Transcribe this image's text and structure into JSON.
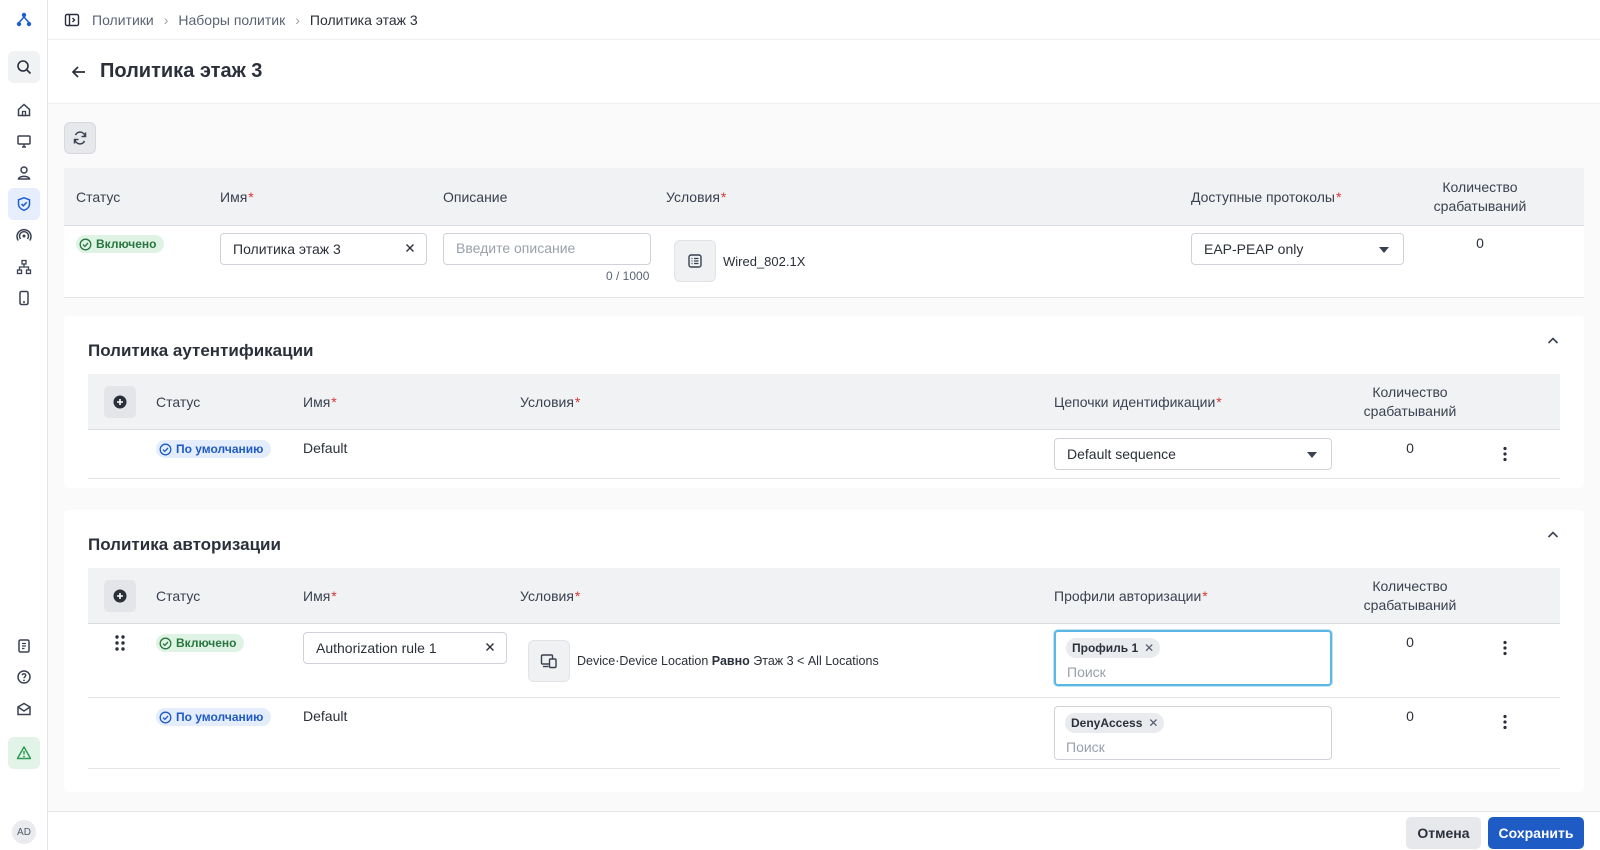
{
  "nav": {
    "avatar_initials": "AD",
    "icons": [
      "logo-icon",
      "search-icon",
      "home-icon",
      "monitor-icon",
      "user-icon",
      "shield-icon",
      "broadcast-icon",
      "network-icon",
      "mobile-icon",
      "document-icon",
      "help-icon",
      "mail-icon",
      "alert-icon"
    ]
  },
  "breadcrumb": [
    "Политики",
    "Наборы политик",
    "Политика этаж 3"
  ],
  "page": {
    "title": "Политика этаж 3"
  },
  "policy_set": {
    "headers": {
      "status": "Статус",
      "name": "Имя",
      "description": "Описание",
      "conditions": "Условия",
      "protocols": "Доступные протоколы",
      "hits": "Количество срабатываний"
    },
    "row": {
      "status": "Включено",
      "name": "Политика этаж 3",
      "description_placeholder": "Введите описание",
      "char_count": "0 / 1000",
      "condition": "Wired_802.1X",
      "protocol": "EAP-PEAP only",
      "hits": "0"
    }
  },
  "auth_policy": {
    "title": "Политика аутентификации",
    "headers": {
      "status": "Статус",
      "name": "Имя",
      "conditions": "Условия",
      "chains": "Цепочки идентификации",
      "hits": "Количество срабатываний"
    },
    "rows": [
      {
        "status": "По умолчанию",
        "name": "Default",
        "sequence": "Default sequence",
        "hits": "0"
      }
    ]
  },
  "authz_policy": {
    "title": "Политика авторизации",
    "headers": {
      "status": "Статус",
      "name": "Имя",
      "conditions": "Условия",
      "profiles": "Профили авторизации",
      "hits": "Количество срабатываний"
    },
    "rows": [
      {
        "status": "Включено",
        "name": "Authorization rule 1",
        "condition_prefix": "Device·Device Location",
        "condition_op": "Равно",
        "condition_value": "Этаж 3 < All Locations",
        "profile_tag": "Профиль 1",
        "search_placeholder": "Поиск",
        "hits": "0"
      },
      {
        "status": "По умолчанию",
        "name": "Default",
        "profile_tag": "DenyAccess",
        "search_placeholder": "Поиск",
        "hits": "0"
      }
    ]
  },
  "footer": {
    "cancel": "Отмена",
    "save": "Сохранить"
  },
  "colors": {
    "primary": "#1f5bc4",
    "enabled": "#28773f",
    "required": "#dd3333",
    "focus": "#5bb8e6"
  }
}
